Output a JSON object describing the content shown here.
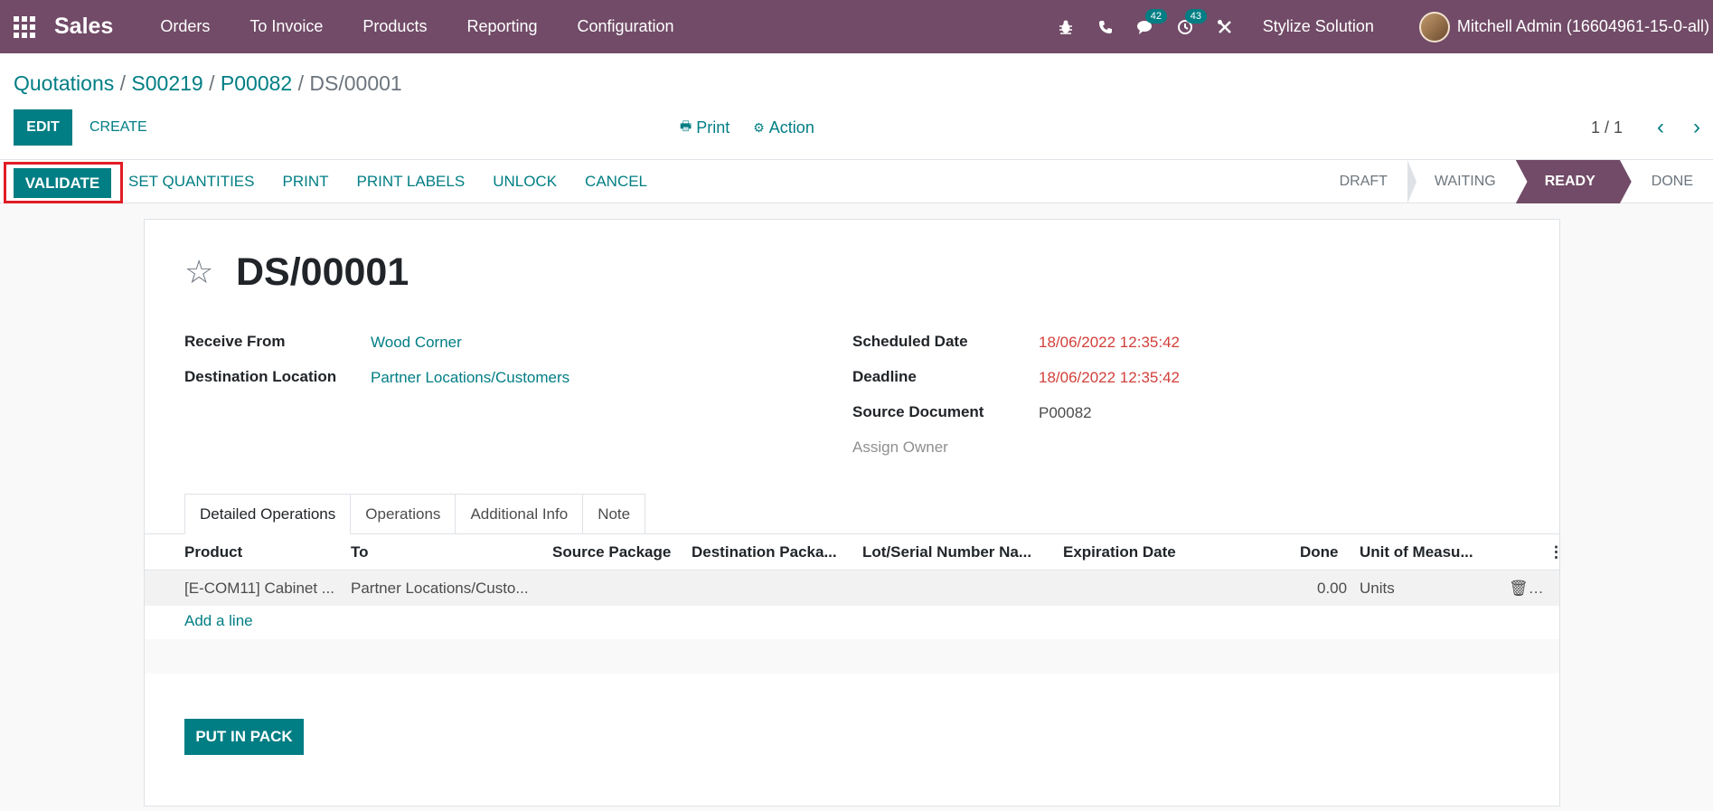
{
  "navbar": {
    "app_name": "Sales",
    "menu": [
      "Orders",
      "To Invoice",
      "Products",
      "Reporting",
      "Configuration"
    ],
    "messages_count": "42",
    "activities_count": "43",
    "company": "Stylize Solution",
    "user": "Mitchell Admin (16604961-15-0-all)"
  },
  "breadcrumb": {
    "items": [
      "Quotations",
      "S00219",
      "P00082"
    ],
    "sep": " / ",
    "current": "DS/00001"
  },
  "control": {
    "edit": "EDIT",
    "create": "CREATE",
    "print": "Print",
    "action": "Action",
    "pager": "1 / 1"
  },
  "statusbar": {
    "validate": "VALIDATE",
    "actions": [
      "SET QUANTITIES",
      "PRINT",
      "PRINT LABELS",
      "UNLOCK",
      "CANCEL"
    ],
    "stages": [
      "DRAFT",
      "WAITING",
      "READY",
      "DONE"
    ],
    "active_stage": "READY"
  },
  "form": {
    "title": "DS/00001",
    "receive_from_label": "Receive From",
    "receive_from": "Wood Corner",
    "destination_label": "Destination Location",
    "destination": "Partner Locations/Customers",
    "scheduled_label": "Scheduled Date",
    "scheduled": "18/06/2022 12:35:42",
    "deadline_label": "Deadline",
    "deadline": "18/06/2022 12:35:42",
    "source_label": "Source Document",
    "source": "P00082",
    "assign_owner": "Assign Owner"
  },
  "tabs": [
    "Detailed Operations",
    "Operations",
    "Additional Info",
    "Note"
  ],
  "table": {
    "columns": [
      "Product",
      "To",
      "Source Package",
      "Destination Packa...",
      "Lot/Serial Number Na...",
      "Expiration Date",
      "Done",
      "Unit of Measu..."
    ],
    "rows": [
      [
        "[E-COM11] Cabinet ...",
        "Partner Locations/Custo...",
        "",
        "",
        "",
        "",
        "0.00",
        "Units"
      ]
    ],
    "add_line": "Add a line"
  },
  "put_in_pack": "PUT IN PACK",
  "colors": {
    "brand": "#714b67",
    "accent": "#017e84",
    "highlight": "#e11d25",
    "date_red": "#d23f3a"
  }
}
